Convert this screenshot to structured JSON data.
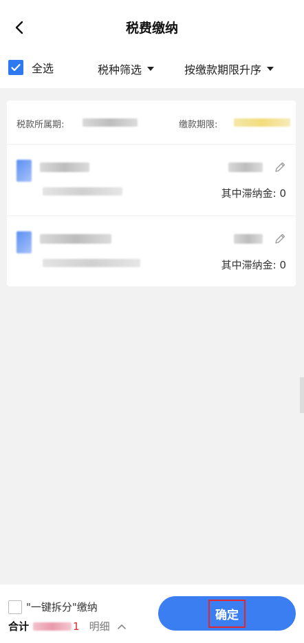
{
  "header": {
    "title": "税费缴纳"
  },
  "filters": {
    "select_all": "全选",
    "tax_type": "税种筛选",
    "sort": "按缴款期限升序"
  },
  "card": {
    "period_label": "税款所属期:",
    "deadline_label": "缴款期限:",
    "items": [
      {
        "late_fee": "其中滞纳金: 0"
      },
      {
        "late_fee": "其中滞纳金: 0"
      }
    ]
  },
  "footer": {
    "split_label": "\"一键拆分\"缴纳",
    "total_label": "合计",
    "total_suffix": "1",
    "detail_label": "明细",
    "confirm_label": "确定"
  },
  "colors": {
    "accent": "#3b7ef2",
    "highlight": "#e0262e"
  }
}
